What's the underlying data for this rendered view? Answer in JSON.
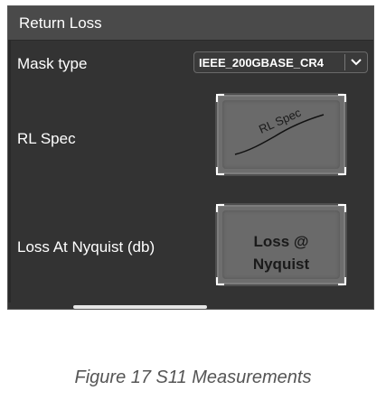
{
  "panel": {
    "title": "Return Loss",
    "mask_type": {
      "label": "Mask type",
      "selected": "IEEE_200GBASE_CR4"
    },
    "rl_spec": {
      "label": "RL Spec",
      "button_text": "RL Spec"
    },
    "loss_nyquist": {
      "label": "Loss At Nyquist (db)",
      "button_line1": "Loss @",
      "button_line2": "Nyquist"
    }
  },
  "caption": "Figure 17  S11 Measurements",
  "colors": {
    "panel_bg": "#333333",
    "header_bg": "#4a4a4a",
    "button_bg": "#6e6e6e",
    "text": "#ffffff",
    "caption": "#555555"
  },
  "icons": {
    "dropdown": "chevron-down-icon"
  }
}
